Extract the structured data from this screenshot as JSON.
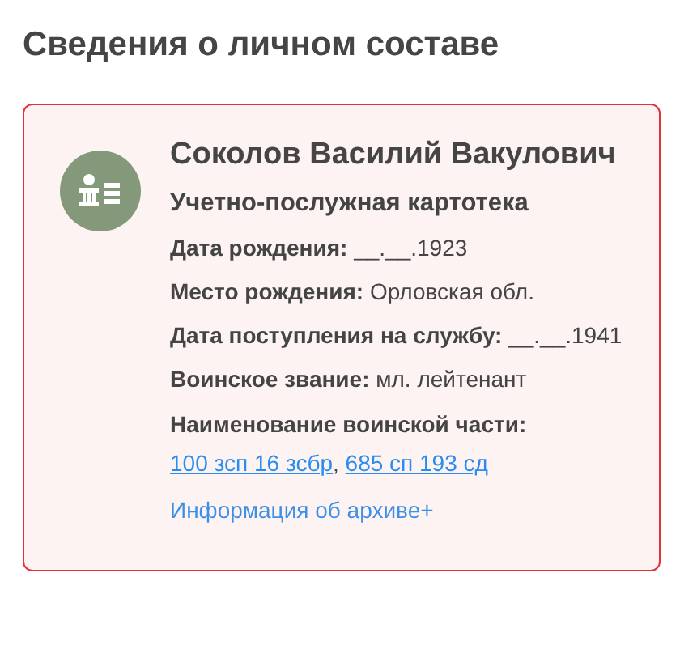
{
  "heading": "Сведения о личном составе",
  "card": {
    "name": "Соколов Василий Вакулович",
    "subtitle": "Учетно-послужная картотека",
    "fields": [
      {
        "label": "Дата рождения:",
        "value": "__.__.1923"
      },
      {
        "label": "Место рождения:",
        "value": "Орловская обл."
      },
      {
        "label": "Дата поступления на службу:",
        "value": "__.__.1941"
      },
      {
        "label": "Воинское звание:",
        "value": "мл. лейтенант"
      }
    ],
    "units": {
      "label": "Наименование воинской части:",
      "separator": ",",
      "links": [
        "100 зсп 16 зсбр",
        "685 сп 193 сд"
      ]
    },
    "archive_link": "Информация об архиве+"
  }
}
